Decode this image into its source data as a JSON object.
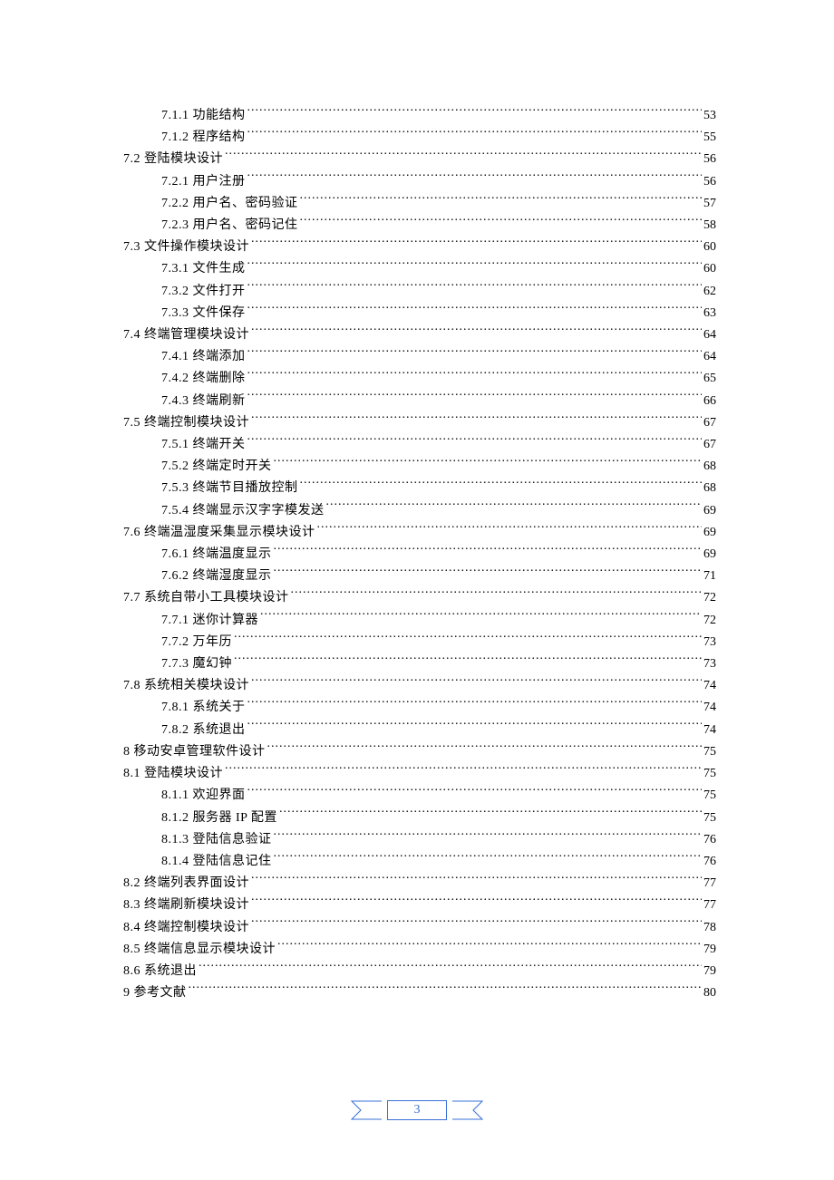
{
  "page_number": "3",
  "toc": [
    {
      "level": 3,
      "text": "7.1.1 功能结构",
      "page": "53"
    },
    {
      "level": 3,
      "text": "7.1.2 程序结构",
      "page": "55"
    },
    {
      "level": 2,
      "text": "7.2 登陆模块设计",
      "page": "56"
    },
    {
      "level": 3,
      "text": "7.2.1 用户注册",
      "page": "56"
    },
    {
      "level": 3,
      "text": "7.2.2 用户名、密码验证",
      "page": "57"
    },
    {
      "level": 3,
      "text": "7.2.3 用户名、密码记住",
      "page": "58"
    },
    {
      "level": 2,
      "text": "7.3 文件操作模块设计",
      "page": "60"
    },
    {
      "level": 3,
      "text": "7.3.1 文件生成",
      "page": "60"
    },
    {
      "level": 3,
      "text": "7.3.2 文件打开",
      "page": "62"
    },
    {
      "level": 3,
      "text": "7.3.3 文件保存",
      "page": "63"
    },
    {
      "level": 2,
      "text": "7.4 终端管理模块设计",
      "page": "64"
    },
    {
      "level": 3,
      "text": "7.4.1 终端添加",
      "page": "64"
    },
    {
      "level": 3,
      "text": "7.4.2 终端删除",
      "page": "65"
    },
    {
      "level": 3,
      "text": "7.4.3 终端刷新",
      "page": "66"
    },
    {
      "level": 2,
      "text": "7.5 终端控制模块设计",
      "page": "67"
    },
    {
      "level": 3,
      "text": "7.5.1 终端开关",
      "page": "67"
    },
    {
      "level": 3,
      "text": "7.5.2 终端定时开关",
      "page": "68"
    },
    {
      "level": 3,
      "text": "7.5.3 终端节目播放控制",
      "page": "68"
    },
    {
      "level": 3,
      "text": "7.5.4 终端显示汉字字模发送",
      "page": "69"
    },
    {
      "level": 2,
      "text": "7.6 终端温湿度采集显示模块设计",
      "page": "69"
    },
    {
      "level": 3,
      "text": "7.6.1 终端温度显示",
      "page": "69"
    },
    {
      "level": 3,
      "text": "7.6.2 终端湿度显示",
      "page": "71"
    },
    {
      "level": 2,
      "text": "7.7 系统自带小工具模块设计",
      "page": "72"
    },
    {
      "level": 3,
      "text": "7.7.1 迷你计算器",
      "page": "72"
    },
    {
      "level": 3,
      "text": "7.7.2 万年历",
      "page": "73"
    },
    {
      "level": 3,
      "text": "7.7.3 魔幻钟",
      "page": "73"
    },
    {
      "level": 2,
      "text": "7.8 系统相关模块设计",
      "page": "74"
    },
    {
      "level": 3,
      "text": "7.8.1 系统关于",
      "page": "74"
    },
    {
      "level": 3,
      "text": "7.8.2 系统退出",
      "page": "74"
    },
    {
      "level": 2,
      "text": "8 移动安卓管理软件设计",
      "page": "75"
    },
    {
      "level": 2,
      "text": "8.1 登陆模块设计",
      "page": "75"
    },
    {
      "level": 3,
      "text": "8.1.1 欢迎界面",
      "page": "75"
    },
    {
      "level": 3,
      "text": "8.1.2 服务器 IP 配置",
      "page": "75"
    },
    {
      "level": 3,
      "text": "8.1.3 登陆信息验证",
      "page": "76"
    },
    {
      "level": 3,
      "text": "8.1.4 登陆信息记住",
      "page": "76"
    },
    {
      "level": 2,
      "text": "8.2 终端列表界面设计",
      "page": "77"
    },
    {
      "level": 2,
      "text": "8.3 终端刷新模块设计",
      "page": "77"
    },
    {
      "level": 2,
      "text": "8.4 终端控制模块设计",
      "page": "78"
    },
    {
      "level": 2,
      "text": "8.5 终端信息显示模块设计",
      "page": "79"
    },
    {
      "level": 2,
      "text": "8.6 系统退出",
      "page": "79"
    },
    {
      "level": 2,
      "text": "9 参考文献",
      "page": "80"
    }
  ]
}
